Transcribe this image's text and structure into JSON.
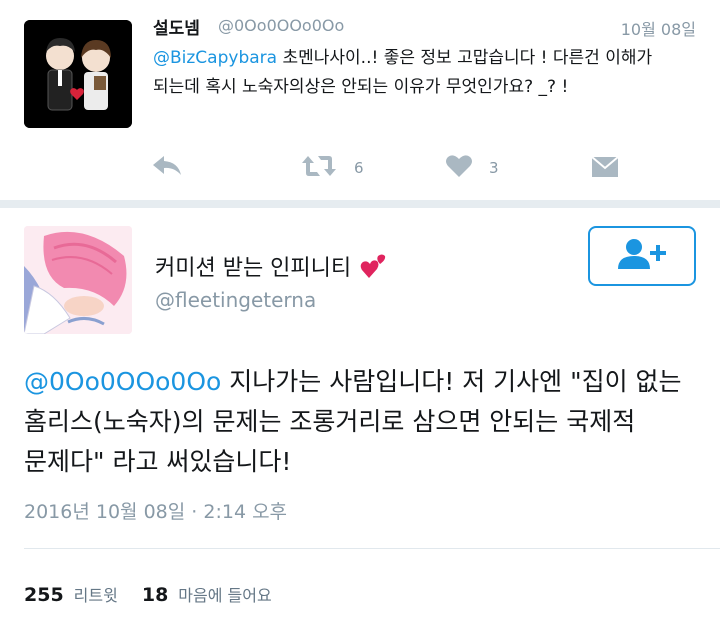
{
  "reply_tweet": {
    "author_name": "설도넴",
    "author_handle": "@0Oo0OOo0Oo",
    "date": "10월 08일",
    "mention": "@BizCapybara",
    "text": " 초멘나사이..! 좋은 정보 고맙습니다 ! 다른건 이해가 되는데 혹시 노숙자의상은 안되는 이유가 무엇인가요? _? !",
    "actions": {
      "reply_icon": "reply-icon",
      "retweet_icon": "retweet-icon",
      "retweet_count": "6",
      "like_icon": "heart-icon",
      "like_count": "3",
      "dm_icon": "envelope-icon"
    }
  },
  "main_tweet": {
    "author_name": "커미션 받는 인피니티",
    "author_handle": "@fleetingeterna",
    "follow_icon": "add-user-icon",
    "mention": "@0Oo0OOo0Oo",
    "text": " 지나가는 사람입니다! 저 기사엔 \"집이 없는 홈리스(노숙자)의 문제는 조롱거리로 삼으면 안되는 국제적 문제다\" 라고 써있습니다!",
    "timestamp_date": "2016년 10월 08일",
    "timestamp_sep": " · ",
    "timestamp_time": "2:14 오후",
    "stats": {
      "retweets_count": "255",
      "retweets_label": "리트윗",
      "likes_count": "18",
      "likes_label": "마음에 들어요"
    }
  },
  "colors": {
    "accent": "#1b95e0",
    "muted": "#8899a6",
    "text": "#14171a",
    "divider": "#e6ecf0"
  }
}
